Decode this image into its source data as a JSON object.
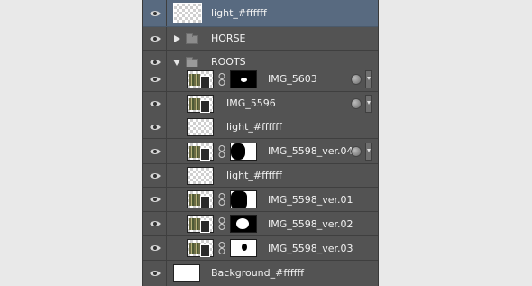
{
  "layers": [
    {
      "id": "light1",
      "name": "light_#ffffff",
      "type": "layer",
      "selected": true
    },
    {
      "id": "horse",
      "name": "HORSE",
      "type": "group",
      "expanded": false
    },
    {
      "id": "roots",
      "name": "ROOTS",
      "type": "group",
      "expanded": true
    },
    {
      "id": "img5603",
      "name": "IMG_5603",
      "type": "masked",
      "effects": true
    },
    {
      "id": "img5596",
      "name": "IMG_5596",
      "type": "layer",
      "effects": true
    },
    {
      "id": "light2",
      "name": "light_#ffffff",
      "type": "layer"
    },
    {
      "id": "img5598v04",
      "name": "IMG_5598_ver.04",
      "type": "masked",
      "effects": true
    },
    {
      "id": "light3",
      "name": "light_#ffffff",
      "type": "layer"
    },
    {
      "id": "img5598v01",
      "name": "IMG_5598_ver.01",
      "type": "masked"
    },
    {
      "id": "img5598v02",
      "name": "IMG_5598_ver.02",
      "type": "masked"
    },
    {
      "id": "img5598v03",
      "name": "IMG_5598_ver.03",
      "type": "masked"
    },
    {
      "id": "background",
      "name": "Background_#ffffff",
      "type": "layer"
    }
  ],
  "colors": {
    "panel": "#535353",
    "selected": "#586a80",
    "text": "#f2f2f2"
  },
  "icons": [
    "eye-icon",
    "folder-icon",
    "chain-link-icon",
    "effects-icon",
    "disclosure-triangle-icon"
  ]
}
